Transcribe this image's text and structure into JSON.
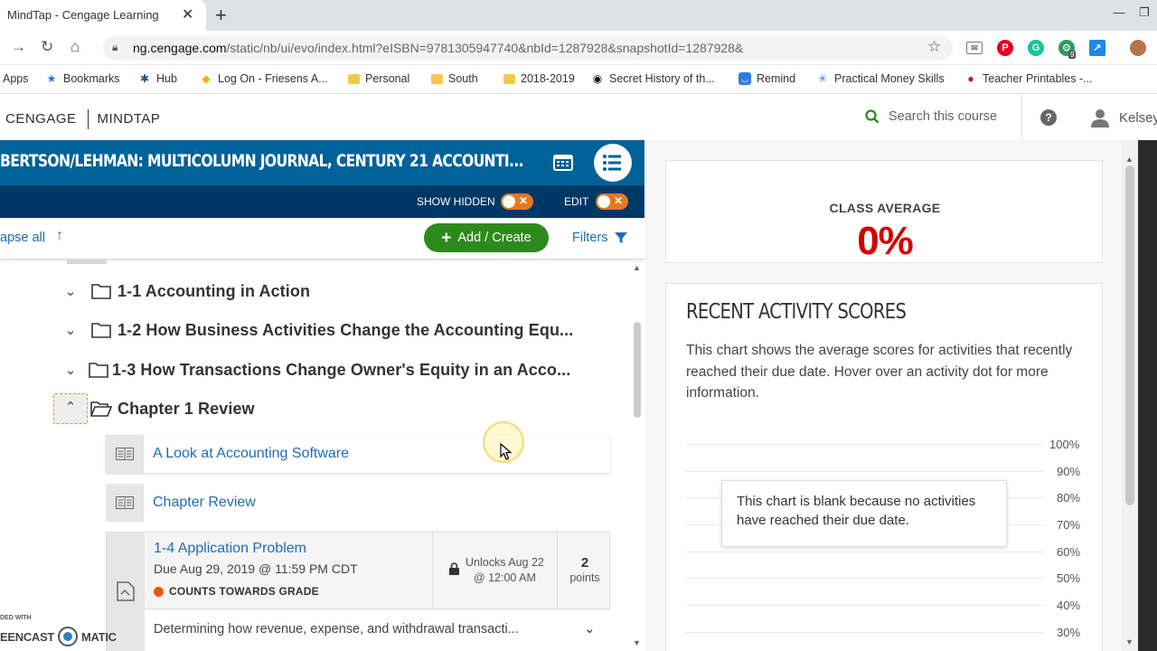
{
  "browser": {
    "tab_title": "MindTap - Cengage Learning",
    "tab_close": "✕",
    "new_tab": "+",
    "url_host": "ng.cengage.com",
    "url_path": "/static/nb/ui/evo/index.html?eISBN=9781305947740&nbId=1287928&snapshotId=1287928&",
    "extension_badge": "9"
  },
  "bookmarks": [
    {
      "label": "Apps",
      "icon": "apps-grid-icon"
    },
    {
      "label": "Bookmarks",
      "icon": "star-icon"
    },
    {
      "label": "Hub",
      "icon": "hub-icon"
    },
    {
      "label": "Log On - Friesens A...",
      "icon": "diamond-icon"
    },
    {
      "label": "Personal",
      "icon": "folder-icon"
    },
    {
      "label": "South",
      "icon": "folder-icon"
    },
    {
      "label": "2018-2019",
      "icon": "folder-icon"
    },
    {
      "label": "Secret History of th...",
      "icon": "circle-icon"
    },
    {
      "label": "Remind",
      "icon": "remind-icon"
    },
    {
      "label": "Practical Money Skills",
      "icon": "snowflake-icon"
    },
    {
      "label": "Teacher Printables -...",
      "icon": "apple-icon"
    }
  ],
  "header": {
    "brand_left": "CENGAGE",
    "brand_right": "MINDTAP",
    "search_placeholder": "Search this course",
    "help": "?",
    "user": "Kelsey"
  },
  "course": {
    "title": "BERTSON/LEHMAN: MULTICOLUMN JOURNAL, CENTURY 21 ACCOUNTI...",
    "show_hidden_label": "SHOW HIDDEN",
    "edit_label": "EDIT",
    "collapse_all": "apse all",
    "add_create": "Add / Create",
    "filters": "Filters"
  },
  "tree": [
    {
      "label": "1-1 Accounting in Action",
      "expanded": false
    },
    {
      "label": "1-2 How Business Activities Change the Accounting Equ...",
      "expanded": false
    },
    {
      "label": "1-3 How Transactions Change Owner's Equity in an Acco...",
      "expanded": false
    },
    {
      "label": "Chapter 1 Review",
      "expanded": true
    }
  ],
  "activities": [
    {
      "label": "A Look at Accounting Software"
    },
    {
      "label": "Chapter Review"
    }
  ],
  "application_problem": {
    "title": "1-4 Application Problem",
    "due": "Due Aug 29, 2019 @ 11:59 PM CDT",
    "counts": "COUNTS TOWARDS GRADE",
    "unlock_line1": "Unlocks Aug 22",
    "unlock_line2": "@ 12:00 AM",
    "points": "2",
    "points_label": "points",
    "description": "Determining how revenue, expense, and withdrawal transacti..."
  },
  "watermark": {
    "line1": "DED WITH",
    "line2": "EENCAST",
    "line3": "MATIC"
  },
  "class_average": {
    "label": "CLASS AVERAGE",
    "value": "0%"
  },
  "recent_scores": {
    "title": "RECENT ACTIVITY SCORES",
    "description": "This chart shows the average scores for activities that recently reached their due date. Hover over an activity dot for more information.",
    "blank_message": "This chart is blank because no activities have reached their due date.",
    "y_ticks": [
      "100%",
      "90%",
      "80%",
      "70%",
      "60%",
      "50%",
      "40%",
      "30%"
    ]
  },
  "colors": {
    "course_bar": "#006298",
    "show_bar": "#003865",
    "toggle": "#e87722",
    "add_button": "#2c8a1b",
    "link": "#1f6db3",
    "average": "#d40000"
  }
}
